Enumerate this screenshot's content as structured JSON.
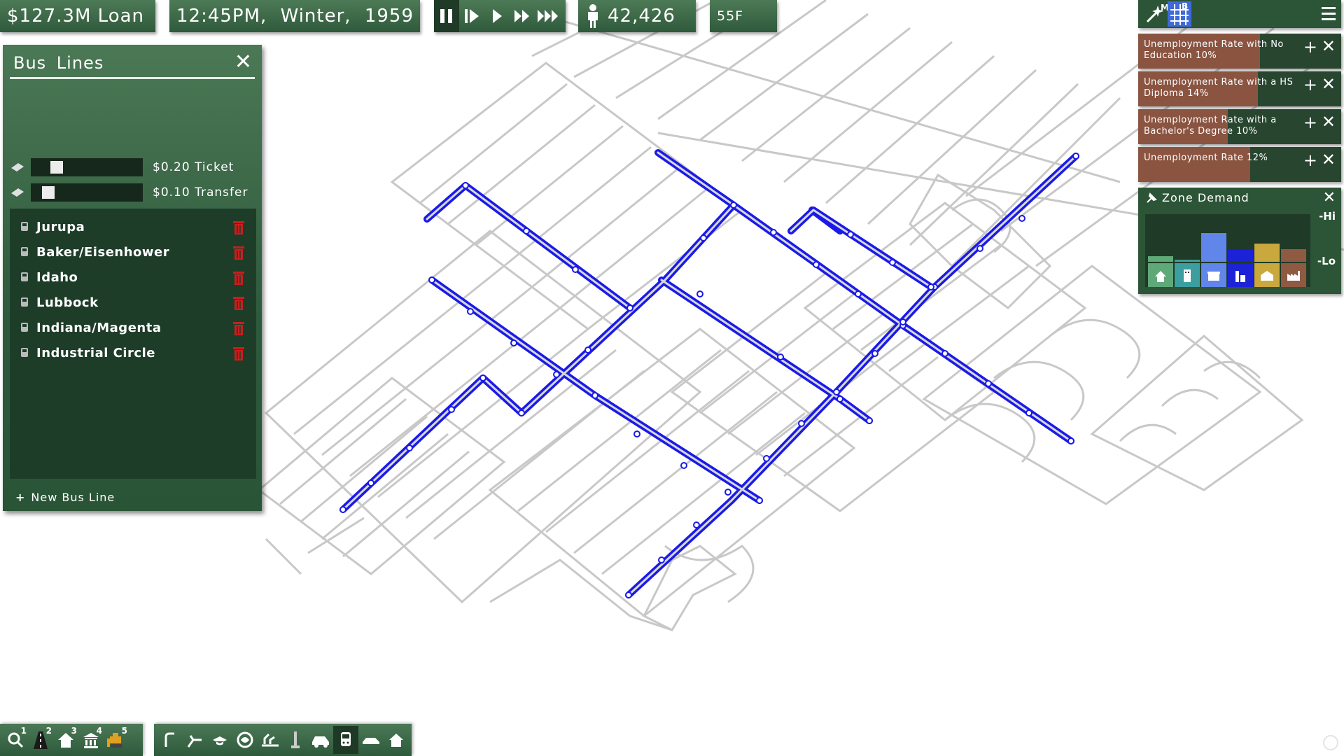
{
  "top_bar": {
    "loan": "$127.3M Loan",
    "datetime": "12:45PM, Winter, 1959",
    "population": "42,426",
    "temperature": "55F"
  },
  "bus_panel": {
    "title": "Bus Lines",
    "ticket_label": "$0.20 Ticket",
    "transfer_label": "$0.10 Transfer",
    "lines": [
      {
        "name": "Jurupa"
      },
      {
        "name": "Baker/Eisenhower"
      },
      {
        "name": "Idaho"
      },
      {
        "name": "Lubbock"
      },
      {
        "name": "Indiana/Magenta"
      },
      {
        "name": "Industrial Circle"
      }
    ],
    "new_line_label": "New Bus Line"
  },
  "mode_toggle": {
    "m_label": "M",
    "b_label": "B"
  },
  "notifications": [
    {
      "text": "Unemployment Rate with No Education 10%",
      "fill_fraction": 0.6
    },
    {
      "text": "Unemployment Rate with a HS Diploma 14%",
      "fill_fraction": 0.59
    },
    {
      "text": "Unemployment Rate with a Bachelor's Degree 10%",
      "fill_fraction": 0.44
    },
    {
      "text": "Unemployment Rate 12%",
      "fill_fraction": 0.55
    }
  ],
  "zone_demand": {
    "title": "Zone Demand",
    "hi_label": "-Hi",
    "lo_label": "-Lo",
    "bars": [
      {
        "zone": "residential-low",
        "value": 0.12,
        "color": "#5fa878"
      },
      {
        "zone": "residential-high",
        "value": 0.05,
        "color": "#3d9ea0"
      },
      {
        "zone": "commercial-low",
        "value": 0.62,
        "color": "#5f86e8"
      },
      {
        "zone": "commercial-high",
        "value": 0.25,
        "color": "#1c22d6"
      },
      {
        "zone": "industrial-low",
        "value": 0.4,
        "color": "#c9a83e"
      },
      {
        "zone": "industrial-high",
        "value": 0.28,
        "color": "#8e5a42"
      }
    ]
  },
  "toolbar": {
    "group1": [
      {
        "icon": "magnifier-icon",
        "key": "1"
      },
      {
        "icon": "road-icon",
        "key": "2"
      },
      {
        "icon": "house-icon",
        "key": "3"
      },
      {
        "icon": "government-icon",
        "key": "4"
      },
      {
        "icon": "bulldozer-icon",
        "key": "5"
      }
    ],
    "group2": [
      {
        "icon": "road-tool-icon"
      },
      {
        "icon": "expressway-icon"
      },
      {
        "icon": "hat-icon"
      },
      {
        "icon": "park-icon"
      },
      {
        "icon": "water-icon"
      },
      {
        "icon": "tower-icon"
      },
      {
        "icon": "car-icon"
      },
      {
        "icon": "bus-icon"
      },
      {
        "icon": "car-flat-icon"
      },
      {
        "icon": "home-icon"
      }
    ]
  },
  "colors": {
    "panel_green": "#2e5a3c",
    "bus_route": "#1a1ae8",
    "road": "#c8c8c8",
    "notification_fill": "#8a5441",
    "delete_icon": "#c81e1e"
  }
}
